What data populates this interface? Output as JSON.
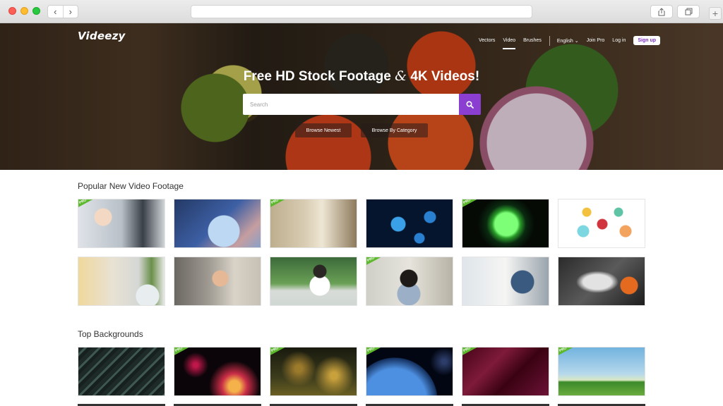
{
  "browser": {
    "back_icon": "‹",
    "forward_icon": "›",
    "new_tab_icon": "+"
  },
  "header": {
    "logo": "Videezy",
    "nav": {
      "vectors": "Vectors",
      "video": "Video",
      "brushes": "Brushes",
      "language": "English ⌄",
      "join_pro": "Join Pro",
      "log_in": "Log in",
      "sign_up": "Sign up"
    }
  },
  "hero": {
    "title_part1": "Free HD Stock Footage ",
    "title_amp": "&",
    "title_part2": " 4K Videos!",
    "search_placeholder": "Search",
    "browse_newest": "Browse Newest",
    "browse_category": "Browse By Category"
  },
  "sections": {
    "popular_title": "Popular New Video Footage",
    "backgrounds_title": "Top Backgrounds",
    "pro_badge": "PRO"
  },
  "colors": {
    "accent_purple": "#8a3fd1",
    "pro_green": "#5cb82d"
  }
}
